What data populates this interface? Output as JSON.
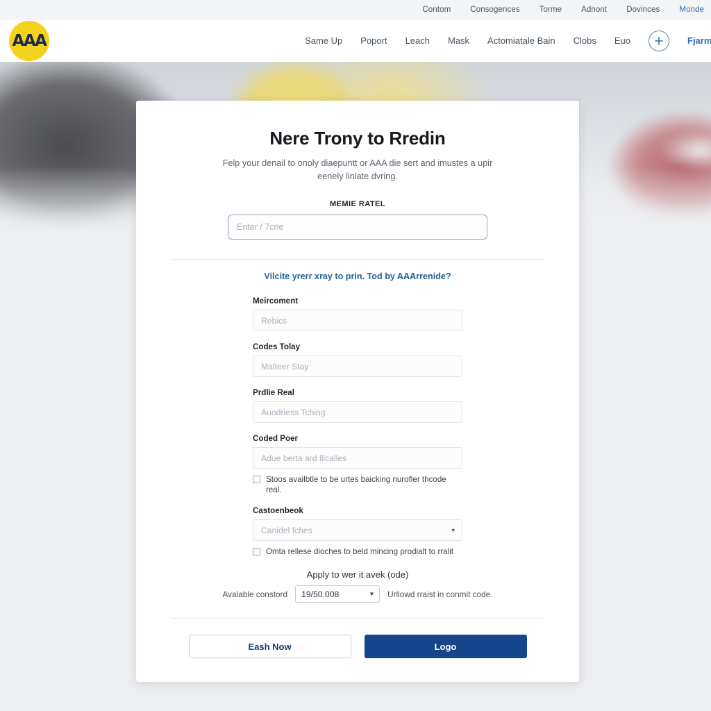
{
  "utility_bar": {
    "items": [
      {
        "label": "Contom",
        "accent": false
      },
      {
        "label": "Consogences",
        "accent": false
      },
      {
        "label": "Torme",
        "accent": false
      },
      {
        "label": "Adnont",
        "accent": false
      },
      {
        "label": "Dovinces",
        "accent": false
      },
      {
        "label": "Monde",
        "accent": true
      }
    ]
  },
  "header": {
    "logo_text": "AAA",
    "nav_items": [
      {
        "label": "Same Up"
      },
      {
        "label": "Poport"
      },
      {
        "label": "Leach"
      },
      {
        "label": "Mask"
      },
      {
        "label": "Actomiatale Bain"
      },
      {
        "label": "Clobs"
      },
      {
        "label": "Euo"
      }
    ],
    "plus_icon": "plus-icon",
    "cta_label": "Fjarm"
  },
  "card": {
    "title": "Nere Trony to Rredin",
    "subtitle": "Felp your denail to onoly diaepuntt or AAA die sert and imustes a upir eenely linlate dvring.",
    "member_label": "MEMIE RATEL",
    "member_placeholder": "Enter / 7cne",
    "member_value": "",
    "help_link": "Vilcite yrerr xray to prin. Tod by AAArrenide?",
    "fields": [
      {
        "label": "Meircoment",
        "placeholder": "Rebics",
        "value": ""
      },
      {
        "label": "Codes Tolay",
        "placeholder": "Malteer Stay",
        "value": ""
      },
      {
        "label": "Prdlie Real",
        "placeholder": "Auodriess Tching",
        "value": ""
      },
      {
        "label": "Coded Poer",
        "placeholder": "Adue berta ard llicalles",
        "value": ""
      }
    ],
    "checkbox_one": "Stoos availbtle to be urtes baicking nurofler thcode real.",
    "select_label": "Castoenbeok",
    "select_placeholder": "Canidel fches",
    "select_caret": "caret-down-icon",
    "checkbox_two": "Omta rellese dioches to beld mincing prodialt to rralit",
    "promo_title": "Apply to wer it avek (ode)",
    "promo_left_label": "Avalable constord",
    "promo_select_value": "19/50.008",
    "promo_right_label": "Urllowd rraist in conmit code.",
    "secondary_button": "Eash Now",
    "primary_button": "Logo"
  },
  "colors": {
    "brand_yellow": "#f2d21a",
    "brand_navy": "#17458c",
    "link_blue": "#2a6099",
    "page_bg": "#eceef1"
  }
}
